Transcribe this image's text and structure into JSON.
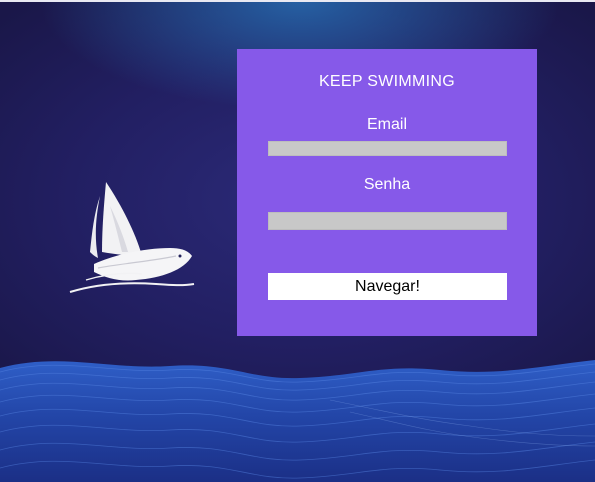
{
  "login": {
    "title": "KEEP SWIMMING",
    "email_label": "Email",
    "email_value": "",
    "password_label": "Senha",
    "password_value": "",
    "submit_label": "Navegar!"
  },
  "colors": {
    "panel": "#8659e9",
    "background": "#221f62",
    "field": "#c8c8c8",
    "button": "#ffffff",
    "wave": "#3b6fd6"
  },
  "icons": {
    "logo": "sailboat-icon"
  }
}
